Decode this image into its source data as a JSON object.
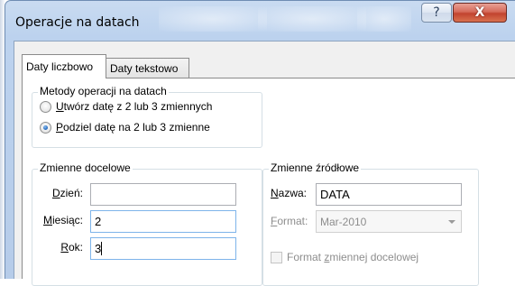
{
  "window": {
    "title": "Operacje na datach",
    "help_glyph": "?",
    "close_glyph": "X"
  },
  "tabs": [
    {
      "label": "Daty liczbowo",
      "active": true
    },
    {
      "label": "Daty tekstowo",
      "active": false
    }
  ],
  "methods": {
    "legend": "Metody operacji na datach",
    "options": [
      {
        "mnemonic": "U",
        "rest": "twórz datę z 2 lub 3 zmiennych",
        "checked": false
      },
      {
        "mnemonic": "P",
        "rest": "odziel datę na 2 lub 3 zmienne",
        "checked": true
      }
    ]
  },
  "target_vars": {
    "legend": "Zmienne docelowe",
    "fields": [
      {
        "mnemonic": "D",
        "rest": "zień:",
        "value": ""
      },
      {
        "mnemonic": "M",
        "rest": "iesiąc:",
        "value": "2"
      },
      {
        "mnemonic": "R",
        "rest": "ok:",
        "value": "3"
      }
    ]
  },
  "source_vars": {
    "legend": "Zmienne źródłowe",
    "name_label_mnemonic": "N",
    "name_label_rest": "azwa:",
    "name_value": "DATA",
    "format_label_mnemonic": "F",
    "format_label_rest": "ormat:",
    "format_value": "Mar-2010",
    "checkbox_label_pre": "Format ",
    "checkbox_label_mnemonic": "z",
    "checkbox_label_rest": "miennej docelowej",
    "checkbox_checked": false
  },
  "colors": {
    "titlebar": "#bcd2ee",
    "close_button": "#c2432f",
    "radio_dot": "#2a6fc2",
    "focus_border": "#7eb4ea"
  }
}
